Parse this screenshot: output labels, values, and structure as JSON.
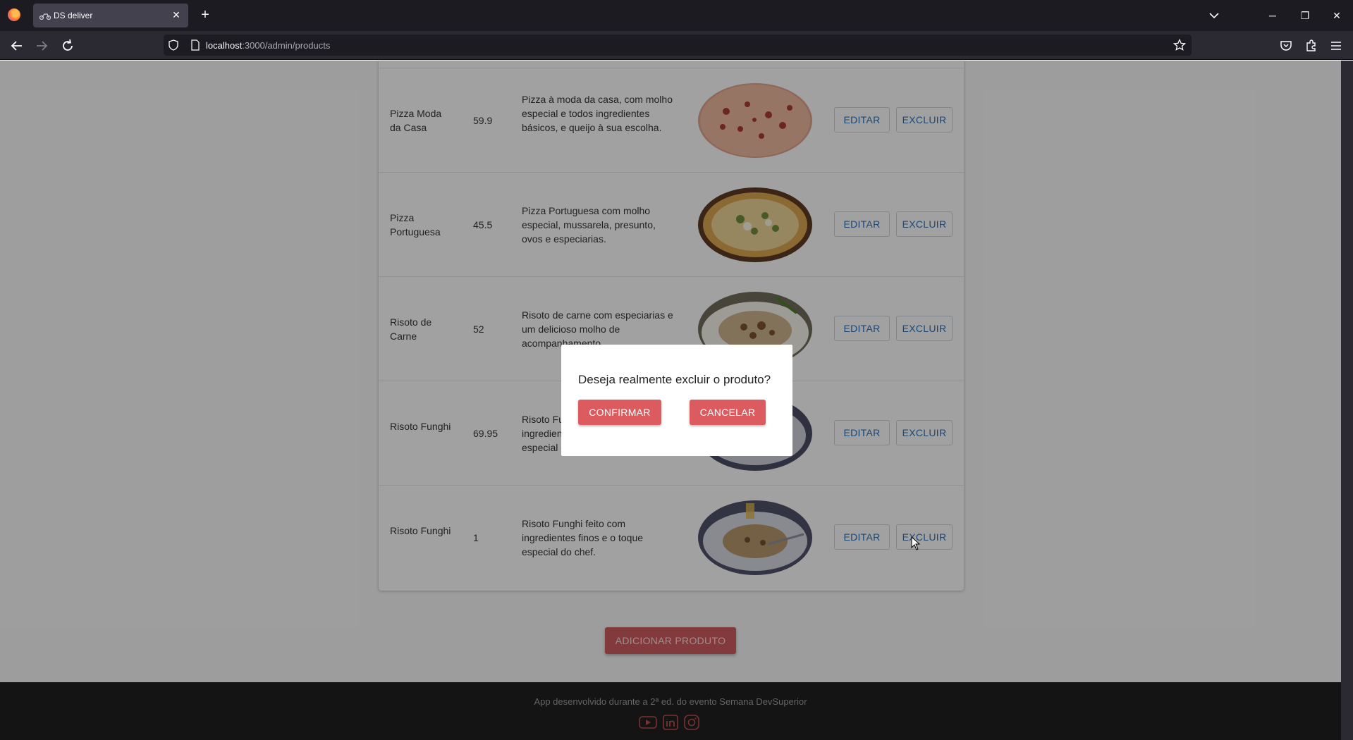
{
  "browser": {
    "tab_title": "DS deliver",
    "url_host": "localhost",
    "url_path": ":3000/admin/products"
  },
  "products": [
    {
      "name": "Pizza Moda da Casa",
      "price": "59.9",
      "description": "Pizza à moda da casa, com molho especial e todos ingredientes básicos, e queijo à sua escolha.",
      "image": "pizza-moda-casa-photo"
    },
    {
      "name": "Pizza Portuguesa",
      "price": "45.5",
      "description": "Pizza Portuguesa com molho especial, mussarela, presunto, ovos e especiarias.",
      "image": "pizza-portuguesa-photo"
    },
    {
      "name": "Risoto de Carne",
      "price": "52",
      "description": "Risoto de carne com especiarias e um delicioso molho de acompanhamento.",
      "image": "risoto-carne-photo"
    },
    {
      "name": "Risoto Funghi",
      "price": "69.95",
      "description": "Risoto Funghi feito com ingredientes finos e o toque especial do chef.",
      "image": "risoto-funghi-photo"
    },
    {
      "name": "Risoto Funghi",
      "price": "1",
      "description": "Risoto Funghi feito com ingredientes finos e o toque especial do chef.",
      "image": "risoto-funghi-photo"
    }
  ],
  "actions": {
    "edit_label": "EDITAR",
    "delete_label": "EXCLUIR",
    "add_label": "ADICIONAR PRODUTO"
  },
  "footer": {
    "text": "App desenvolvido durante a 2ª ed. do evento Semana DevSuperior",
    "icons": [
      "youtube-icon",
      "linkedin-icon",
      "instagram-icon"
    ]
  },
  "modal": {
    "question": "Deseja realmente excluir o produto?",
    "confirm_label": "CONFIRMAR",
    "cancel_label": "CANCELAR"
  },
  "colors": {
    "accent_red": "#db5b5e",
    "link_blue": "#2f6fb3",
    "footer_bg": "#1f1f1f"
  }
}
